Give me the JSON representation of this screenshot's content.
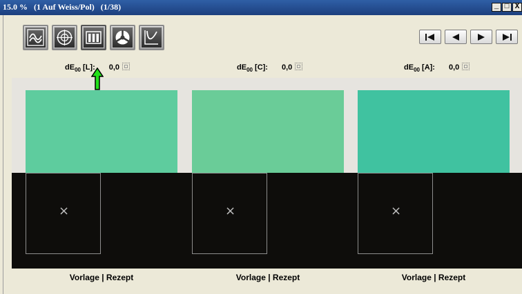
{
  "window": {
    "title": "15.0 %   (1 Auf Weiss/Pol)   (1/38)",
    "buttons": {
      "minimize": "_",
      "maximize": "□",
      "close": "X"
    }
  },
  "toolbar": {
    "buttons": [
      {
        "icon": "curve-chart-icon",
        "active": false
      },
      {
        "icon": "crosshair-target-icon",
        "active": false
      },
      {
        "icon": "bar-columns-icon",
        "active": true
      },
      {
        "icon": "pie-segments-icon",
        "active": false
      },
      {
        "icon": "u-curve-icon",
        "active": false
      }
    ]
  },
  "navigation": {
    "buttons": [
      "skip-to-first-icon",
      "previous-icon",
      "next-icon",
      "skip-to-last-icon"
    ]
  },
  "metrics": [
    {
      "label_prefix": "dE",
      "sub": "00",
      "label_suffix": " [L]:",
      "value": "0,0"
    },
    {
      "label_prefix": "dE",
      "sub": "00",
      "label_suffix": " [C]:",
      "value": "0,0"
    },
    {
      "label_prefix": "dE",
      "sub": "00",
      "label_suffix": " [A]:",
      "value": "0,0"
    }
  ],
  "swatches": [
    {
      "color": "#5ecc9e",
      "caption": "Vorlage | Rezept"
    },
    {
      "color": "#6acc98",
      "caption": "Vorlage | Rezept"
    },
    {
      "color": "#40c2a0",
      "caption": "Vorlage | Rezept"
    }
  ],
  "sample_mark": "×",
  "colors": {
    "titlebar": "#1c3f7e",
    "background": "#ece9d8",
    "black_band": "#0e0d0b",
    "arrow": "#22e01a"
  }
}
